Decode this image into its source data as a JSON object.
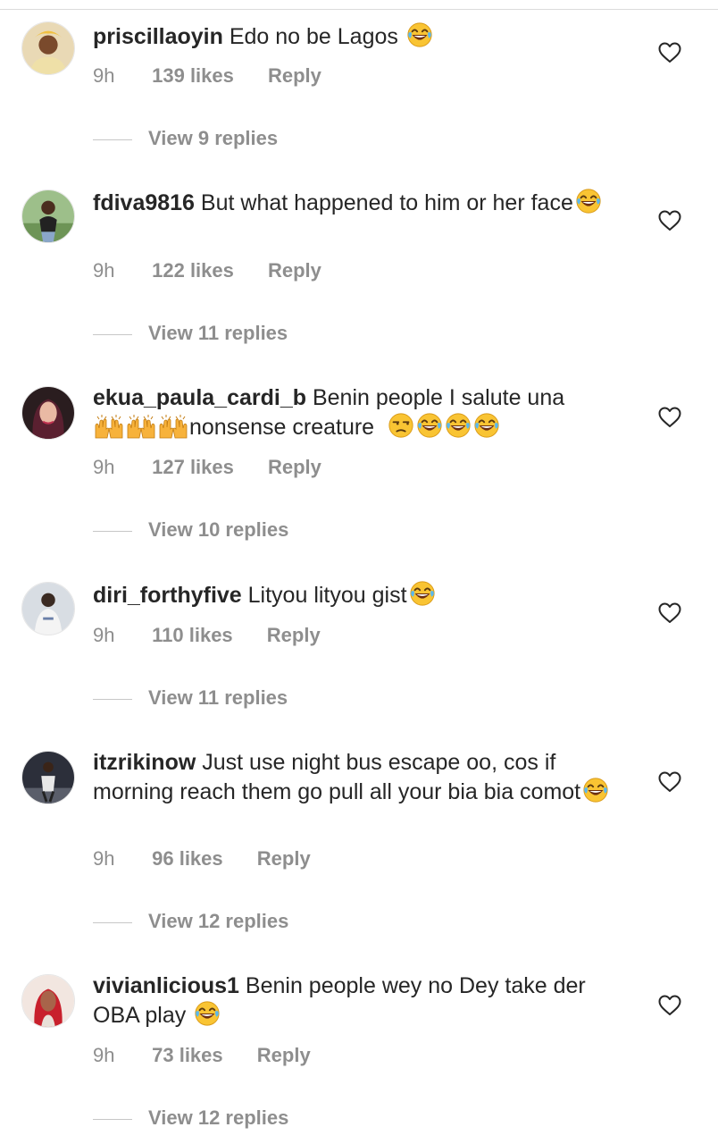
{
  "comments": [
    {
      "username": "priscillaoyin",
      "text": "Edo no be Lagos",
      "time": "9h",
      "likes": "139 likes",
      "reply": "Reply",
      "view_replies": "View 9 replies",
      "trailing_emoji": [
        "laughing-crying-emoji"
      ]
    },
    {
      "username": "fdiva9816",
      "text": "But what happened to him or her face",
      "time": "9h",
      "likes": "122 likes",
      "reply": "Reply",
      "view_replies": "View 11 replies",
      "trailing_emoji": [
        "laughing-crying-emoji"
      ]
    },
    {
      "username": "ekua_paula_cardi_b",
      "text": "Benin people I salute una",
      "text_line2": "nonsense creature",
      "time": "9h",
      "likes": "127 likes",
      "reply": "Reply",
      "view_replies": "View 10 replies",
      "emoji": [
        "raised-hands-emoji",
        "raised-hands-emoji",
        "raised-hands-emoji",
        "unamused-emoji",
        "laughing-crying-emoji",
        "laughing-crying-emoji",
        "laughing-crying-emoji"
      ]
    },
    {
      "username": "diri_forthyfive",
      "text": "Lityou lityou gist",
      "time": "9h",
      "likes": "110 likes",
      "reply": "Reply",
      "view_replies": "View 11 replies",
      "trailing_emoji": [
        "laughing-crying-emoji"
      ]
    },
    {
      "username": "itzrikinow",
      "text": "Just use night bus escape oo, cos if morning reach them go pull all your bia bia comot",
      "time": "9h",
      "likes": "96 likes",
      "reply": "Reply",
      "view_replies": "View 12 replies",
      "trailing_emoji": [
        "laughing-crying-emoji"
      ]
    },
    {
      "username": "vivianlicious1",
      "text": "Benin people wey no Dey take der OBA play",
      "time": "9h",
      "likes": "73 likes",
      "reply": "Reply",
      "view_replies": "View 12 replies",
      "trailing_emoji": [
        "laughing-crying-emoji"
      ]
    }
  ],
  "icons": {
    "like": "heart-outline-icon"
  },
  "colors": {
    "text": "#262626",
    "secondary": "#8e8e8e",
    "emoji_yellow": "#ffcc33"
  }
}
